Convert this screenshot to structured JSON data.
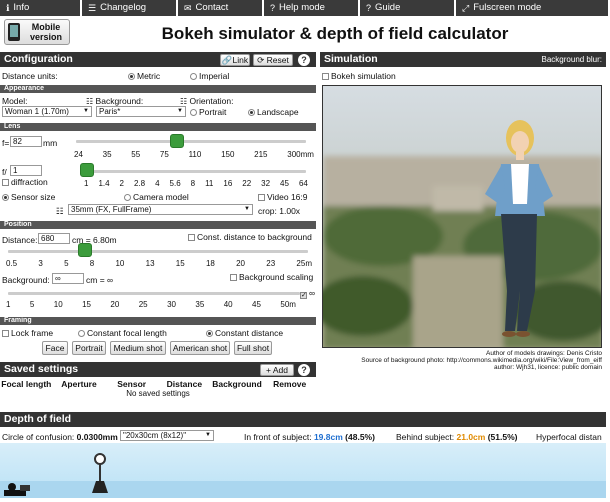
{
  "nav": [
    {
      "icon": "info-icon",
      "glyph": "ℹ",
      "label": "Info"
    },
    {
      "icon": "list-icon",
      "glyph": "☰",
      "label": "Changelog"
    },
    {
      "icon": "envelope-icon",
      "glyph": "✉",
      "label": "Contact"
    },
    {
      "icon": "question-icon",
      "glyph": "?",
      "label": "Help mode"
    },
    {
      "icon": "guide-icon",
      "glyph": "?",
      "label": "Guide"
    },
    {
      "icon": "fullscreen-icon",
      "glyph": "⤢",
      "label": "Fulscreen mode"
    }
  ],
  "mobile_label": "Mobile version",
  "title": "Bokeh simulator & depth of field calculator",
  "config": {
    "header": "Configuration",
    "link": "Link",
    "reset": "Reset",
    "help": "?",
    "distance_units": "Distance units:",
    "metric": "Metric",
    "imperial": "Imperial"
  },
  "appearance": {
    "header": "Appearance",
    "model_label": "Model:",
    "model_value": "Woman 1 (1.70m)",
    "background_label": "Background:",
    "background_value": "Paris*",
    "orientation_label": "Orientation:",
    "portrait": "Portrait",
    "landscape": "Landscape"
  },
  "lens": {
    "header": "Lens",
    "f_label": "f=",
    "f_value": "82",
    "f_unit": "mm",
    "focal_ticks": [
      "24",
      "35",
      "55",
      "75",
      "110",
      "150",
      "215",
      "300mm"
    ],
    "aperture_label": "f/",
    "aperture_value": "1",
    "diffraction": "diffraction",
    "aperture_ticks": [
      "1",
      "1.4",
      "2",
      "2.8",
      "4",
      "5.6",
      "8",
      "11",
      "16",
      "22",
      "32",
      "45",
      "64"
    ],
    "sensor_size": "Sensor size",
    "camera_model": "Camera model",
    "video": "Video 16:9",
    "sensor_value": "35mm (FX, FullFrame)",
    "crop": "crop: 1.00x"
  },
  "position": {
    "header": "Position",
    "distance_label": "Distance:",
    "distance_value": "680",
    "distance_result": "cm = 6.80m",
    "const_distance": "Const. distance to background",
    "distance_ticks": [
      "0.5",
      "3",
      "5",
      "8",
      "10",
      "13",
      "15",
      "18",
      "20",
      "23",
      "25m"
    ],
    "background_label": "Background:",
    "background_value": "∞",
    "background_result": "cm = ∞",
    "background_scaling": "Background scaling",
    "bg_ticks": [
      "1",
      "5",
      "10",
      "15",
      "20",
      "25",
      "30",
      "35",
      "40",
      "45",
      "50m"
    ],
    "infinity": "∞"
  },
  "framing": {
    "header": "Framing",
    "lock_frame": "Lock frame",
    "const_focal": "Constant focal length",
    "const_distance": "Constant distance",
    "buttons": [
      "Face",
      "Portrait",
      "Medium shot",
      "American shot",
      "Full shot"
    ]
  },
  "saved": {
    "header": "Saved settings",
    "add": "Add",
    "help": "?",
    "columns": [
      "Focal length",
      "Aperture",
      "Sensor",
      "Distance",
      "Background",
      "Remove"
    ],
    "empty": "No saved settings"
  },
  "simulation": {
    "header": "Simulation",
    "blur_label": "Background blur:",
    "bokeh_label": "Bokeh simulation",
    "credit1": "Author of models drawings: Denis Cristo",
    "credit2": "Source of background photo: http://commons.wikimedia.org/wiki/File:View_from_eiff",
    "credit3": "author: Wjh31, licence: public domain"
  },
  "dof": {
    "header": "Depth of field",
    "coc_label": "Circle of confusion:",
    "coc_value": "0.0300mm",
    "coc_select": "\"20x30cm (8x12)\"",
    "front_label": "In front of subject:",
    "front_value": "19.8cm",
    "front_pct": "(48.5%)",
    "behind_label": "Behind subject:",
    "behind_value": "21.0cm",
    "behind_pct": "(51.5%)",
    "hyperfocal": "Hyperfocal distan"
  },
  "colors": {
    "front": "#1f6fd0",
    "behind": "#e08a00",
    "slider": "#3c9c3c"
  }
}
